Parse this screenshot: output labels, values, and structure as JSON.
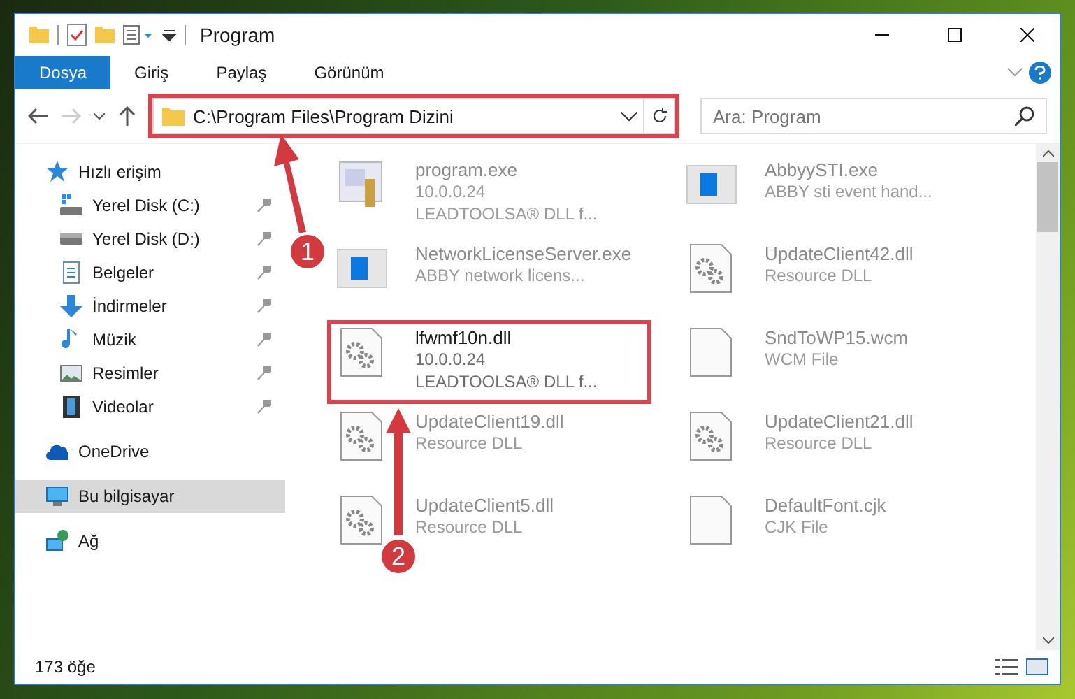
{
  "window": {
    "title": "Program"
  },
  "ribbon": {
    "tabs": [
      {
        "label": "Dosya",
        "selected": true
      },
      {
        "label": "Giriş",
        "selected": false
      },
      {
        "label": "Paylaş",
        "selected": false
      },
      {
        "label": "Görünüm",
        "selected": false
      }
    ]
  },
  "address_bar": {
    "value": "C:\\Program Files\\Program Dizini",
    "highlighted": true
  },
  "search": {
    "placeholder": "Ara: Program"
  },
  "sidebar": {
    "items": [
      {
        "label": "Hızlı erişim",
        "kind": "star",
        "pinned": false,
        "selected": false,
        "children": [
          {
            "label": "Yerel Disk (C:)",
            "kind": "system-drive",
            "pinned": true,
            "selected": false
          },
          {
            "label": "Yerel Disk (D:)",
            "kind": "drive",
            "pinned": true,
            "selected": false
          },
          {
            "label": "Belgeler",
            "kind": "documents",
            "pinned": true,
            "selected": false
          },
          {
            "label": "İndirmeler",
            "kind": "download",
            "pinned": true,
            "selected": false
          },
          {
            "label": "Müzik",
            "kind": "music",
            "pinned": true,
            "selected": false
          },
          {
            "label": "Resimler",
            "kind": "pictures",
            "pinned": true,
            "selected": false
          },
          {
            "label": "Videolar",
            "kind": "videos",
            "pinned": true,
            "selected": false
          }
        ]
      },
      {
        "label": "OneDrive",
        "kind": "cloud",
        "pinned": false,
        "selected": false
      },
      {
        "label": "Bu bilgisayar",
        "kind": "computer",
        "pinned": false,
        "selected": true
      },
      {
        "label": "Ağ",
        "kind": "network",
        "pinned": false,
        "selected": false
      }
    ]
  },
  "files": [
    {
      "name": "program.exe",
      "lines": [
        "10.0.0.24",
        "LEADTOOLSA® DLL f..."
      ],
      "kind": "app",
      "dimmed": true,
      "highlighted": false
    },
    {
      "name": "AbbyySTI.exe",
      "lines": [
        "ABBY sti event hand..."
      ],
      "kind": "window",
      "dimmed": true,
      "highlighted": false
    },
    {
      "name": "NetworkLicenseServer.exe",
      "lines": [
        "ABBY network licens..."
      ],
      "kind": "window",
      "dimmed": true,
      "highlighted": false
    },
    {
      "name": "UpdateClient42.dll",
      "lines": [
        "Resource DLL"
      ],
      "kind": "gear",
      "dimmed": true,
      "highlighted": false
    },
    {
      "name": "lfwmf10n.dll",
      "lines": [
        "10.0.0.24",
        "LEADTOOLSA® DLL f..."
      ],
      "kind": "gear",
      "dimmed": false,
      "highlighted": true
    },
    {
      "name": "SndToWP15.wcm",
      "lines": [
        "WCM File"
      ],
      "kind": "blank",
      "dimmed": true,
      "highlighted": false
    },
    {
      "name": "UpdateClient19.dll",
      "lines": [
        "Resource DLL"
      ],
      "kind": "gear",
      "dimmed": true,
      "highlighted": false
    },
    {
      "name": "UpdateClient21.dll",
      "lines": [
        "Resource DLL"
      ],
      "kind": "gear",
      "dimmed": true,
      "highlighted": false
    },
    {
      "name": "UpdateClient5.dll",
      "lines": [
        "Resource DLL"
      ],
      "kind": "gear",
      "dimmed": true,
      "highlighted": false
    },
    {
      "name": "DefaultFont.cjk",
      "lines": [
        "CJK File"
      ],
      "kind": "blank",
      "dimmed": true,
      "highlighted": false
    }
  ],
  "status_bar": {
    "count": "173 öğe"
  },
  "annotations": [
    {
      "number": "1"
    },
    {
      "number": "2"
    }
  ]
}
